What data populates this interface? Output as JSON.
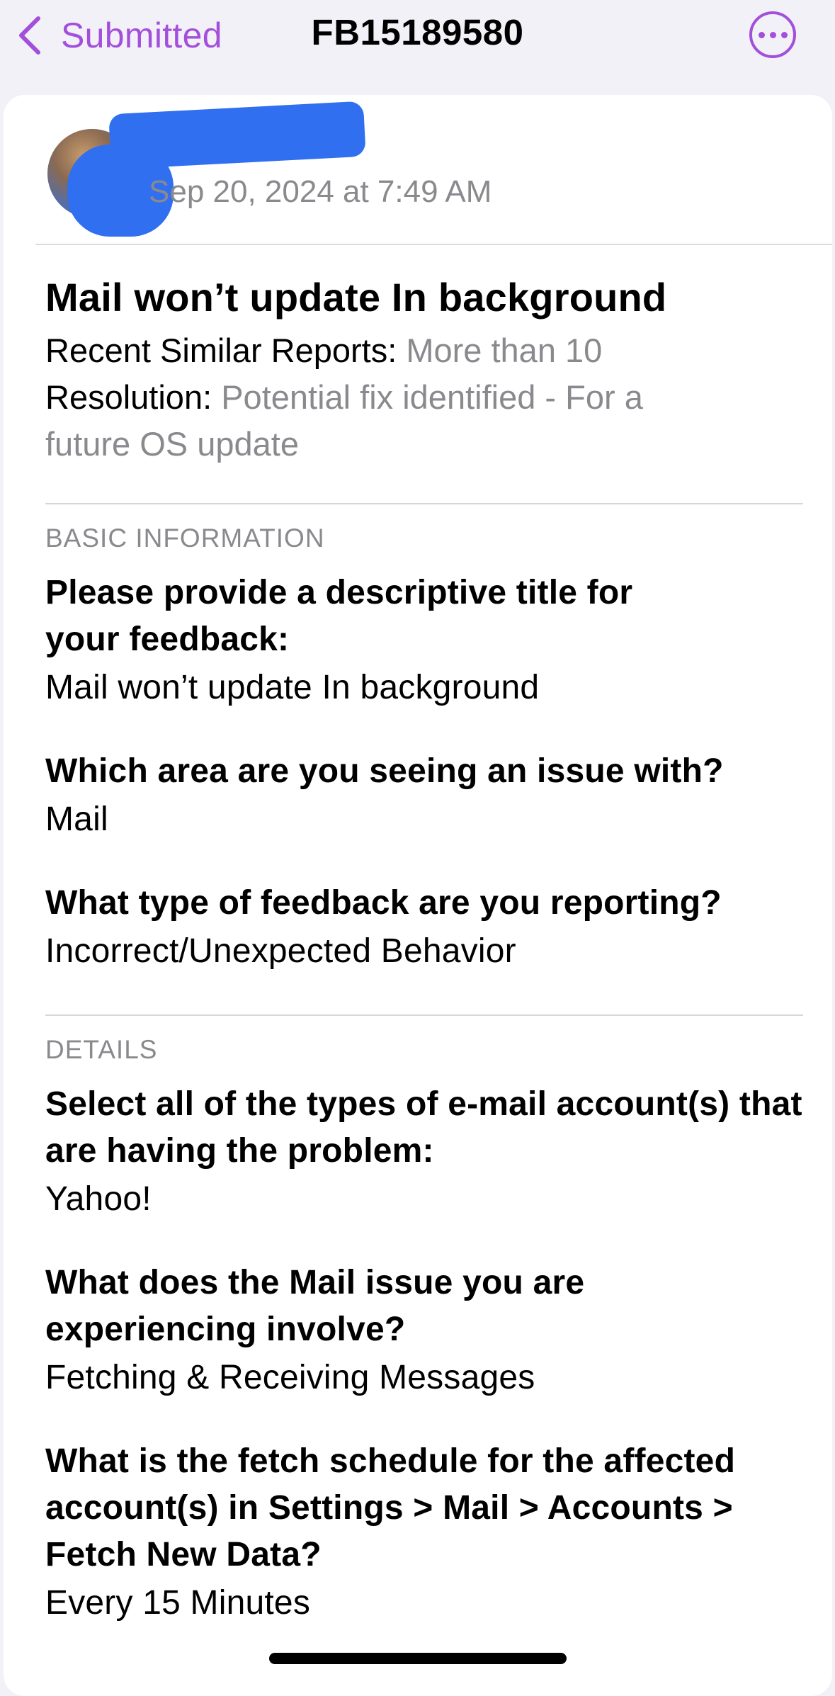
{
  "nav": {
    "back_label": "Submitted",
    "title": "FB15189580",
    "back_icon": "chevron-left-icon",
    "more_icon": "ellipsis-circle-icon",
    "accent_color": "#a34fdc"
  },
  "report": {
    "author": "",
    "timestamp": "Sep 20, 2024 at 7:49 AM",
    "title": "Mail won’t update In background",
    "similar_label": "Recent Similar Reports:",
    "similar_value": "More than 10",
    "resolution_label": "Resolution:",
    "resolution_value": "Potential fix identified - For a future OS update"
  },
  "sections": [
    {
      "header": "BASIC INFORMATION",
      "items": [
        {
          "question": "Please provide a descriptive title for your feedback:",
          "answer": "Mail won’t update In background"
        },
        {
          "question": "Which area are you seeing an issue with?",
          "answer": "Mail"
        },
        {
          "question": "What type of feedback are you reporting?",
          "answer": "Incorrect/Unexpected Behavior"
        }
      ]
    },
    {
      "header": "DETAILS",
      "items": [
        {
          "question": "Select all of the types of e-mail account(s) that are having the problem:",
          "answer": "Yahoo!"
        },
        {
          "question": "What does the Mail issue you are experiencing involve?",
          "answer": "Fetching & Receiving Messages"
        },
        {
          "question": "What is the fetch schedule for the affected account(s) in Settings > Mail > Accounts > Fetch New Data?",
          "answer": "Every 15 Minutes"
        }
      ]
    }
  ]
}
